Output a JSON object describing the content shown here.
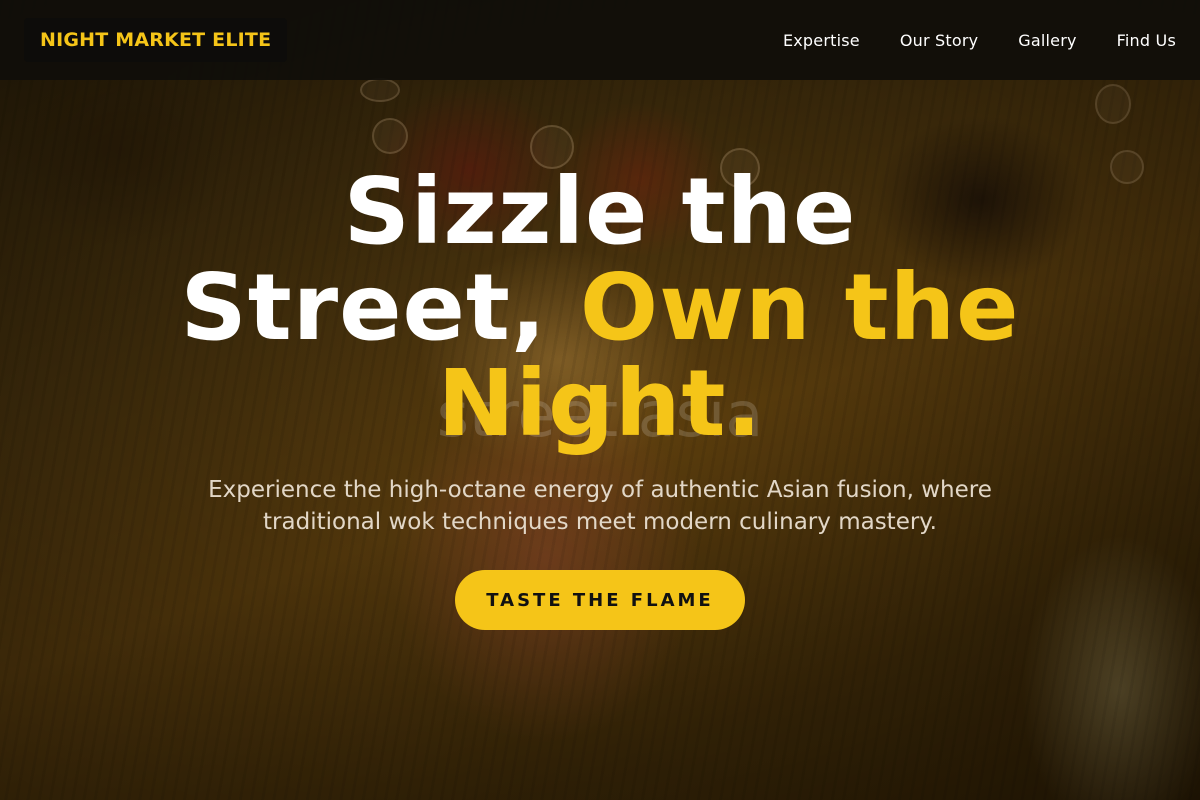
{
  "header": {
    "logo": "NIGHT MARKET ELITE",
    "nav": [
      {
        "label": "Expertise"
      },
      {
        "label": "Our Story"
      },
      {
        "label": "Gallery"
      },
      {
        "label": "Find Us"
      }
    ]
  },
  "hero": {
    "background_text": "street asia",
    "headline_line1": "Sizzle the",
    "headline_line2_plain": "Street, ",
    "headline_line2_accent": "Own the",
    "headline_line3_accent": "Night.",
    "subtitle": "Experience the high-octane energy of authentic Asian fusion, where traditional wok techniques meet modern culinary mastery.",
    "cta_label": "TASTE THE FLAME"
  },
  "colors": {
    "accent": "#f5c518",
    "header_bg": "#100e0a",
    "text": "#ffffff"
  }
}
